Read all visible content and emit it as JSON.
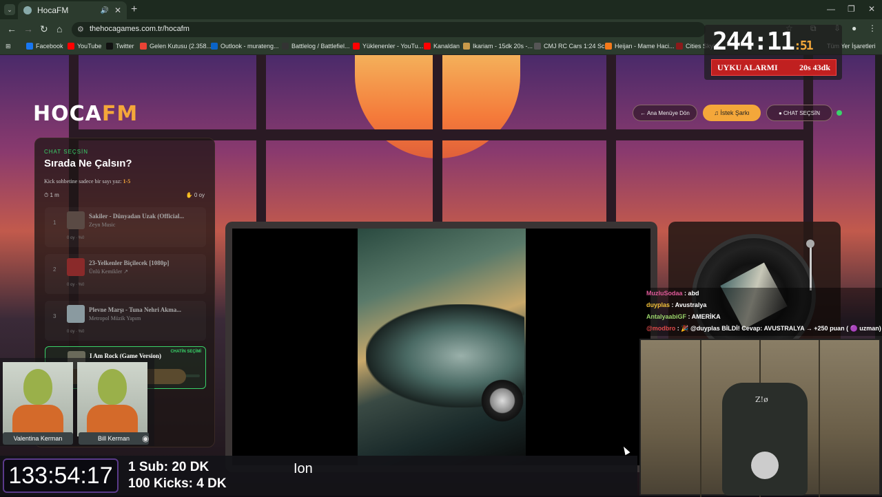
{
  "browser": {
    "tab_title": "HocaFM",
    "url": "thehocagames.com.tr/hocafm",
    "bookmarks": [
      {
        "label": "Facebook",
        "color": "#1877f2"
      },
      {
        "label": "YouTube",
        "color": "#ff0000"
      },
      {
        "label": "Twitter",
        "color": "#111111"
      },
      {
        "label": "Gelen Kutusu (2.358...",
        "color": "#ea4335"
      },
      {
        "label": "Outlook - murateng...",
        "color": "#0a64c8"
      },
      {
        "label": "Battlelog / Battlefiel...",
        "color": "#333333"
      },
      {
        "label": "Yüklenenler - YouTu...",
        "color": "#ff0000"
      },
      {
        "label": "Kanaldan",
        "color": "#ff0000"
      },
      {
        "label": "Ikariam - 15dk 20s -...",
        "color": "#c89a4a"
      },
      {
        "label": "CMJ RC Cars 1:24 Sc...",
        "color": "#555555"
      },
      {
        "label": "Heijan - Mame Haci...",
        "color": "#f47a1a"
      },
      {
        "label": "Cities Skylin...",
        "color": "#8a1a1a"
      }
    ],
    "bookmarks_all": "Tüm Yer İşaretleri"
  },
  "site": {
    "logo_main": "HOCA",
    "logo_accent": "FM",
    "nav": {
      "back": "← Ana Menüye Dön",
      "request": "♫ İstek Şarkı",
      "chat": "● CHAT SEÇSİN"
    }
  },
  "queue": {
    "kicker": "CHAT SEÇSİN",
    "title": "Sırada Ne Çalsın?",
    "hint_prefix": "Kick sohbetine sadece bir sayı yaz: ",
    "hint_range": "1-5",
    "timer": "⏱ 1 m",
    "total_votes": "✋ 0 oy",
    "items": [
      {
        "num": "1",
        "title": "Sakiler - Dünyadan Uzak (Official...",
        "artist": "Zeyn Music",
        "votes": "0 oy · %0"
      },
      {
        "num": "2",
        "title": "23-Yelkenler Biçilecek [1080p]",
        "artist": "Ünlü Kemikler ↗",
        "votes": "0 oy · %0"
      },
      {
        "num": "3",
        "title": "Plevne Marşı - Tuna Nehri Akma...",
        "artist": "Metropol Müzik Yapım",
        "votes": "0 oy · %0"
      },
      {
        "num": "4",
        "title": "I Am Rock (Game Version)",
        "artist": "",
        "votes": "",
        "badge": "CHATİN SEÇİMİ"
      }
    ]
  },
  "chat": [
    {
      "user": "MuzluSodaa",
      "user_color": "#e05a9a",
      "text": " : abd"
    },
    {
      "user": "duyplas",
      "user_color": "#f4c23a",
      "text": " : Avustralya"
    },
    {
      "user": "AntalyaabiGF",
      "user_color": "#9ad36a",
      "text": " : AMERİKA"
    },
    {
      "user": "@modbro",
      "user_color": "#e04a4a",
      "text": " : 🎉 @duyplas BİLDİ! Cevap: AVUSTRALYA → +250 puan ( 🟣 uzman)"
    }
  ],
  "overlay": {
    "big_timer_main": "244:11",
    "big_timer_sec": ":51",
    "alarm_label": "UYKU ALARMI",
    "alarm_value": "20s 43dk",
    "countdown": "133:54:17",
    "sub_line": "1 Sub: 20 DK",
    "kick_line": "100 Kicks: 4 DK",
    "ticker": "Ion",
    "kerbal_left": "Valentina Kerman",
    "kerbal_right": "Bill Kerman",
    "chair_brand": "Z!ø"
  }
}
